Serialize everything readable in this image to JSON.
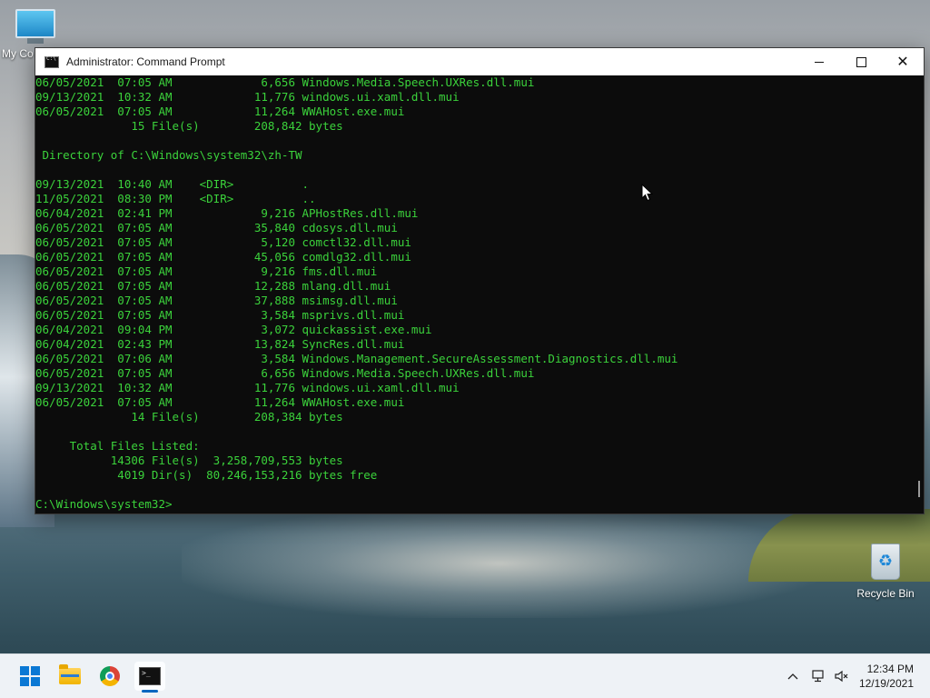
{
  "desktop": {
    "icons": [
      {
        "label": "My Co"
      },
      {
        "label": "Recycle Bin"
      }
    ]
  },
  "window": {
    "title": "Administrator: Command Prompt",
    "console_lines": [
      "06/05/2021  07:05 AM             6,656 Windows.Media.Speech.UXRes.dll.mui",
      "09/13/2021  10:32 AM            11,776 windows.ui.xaml.dll.mui",
      "06/05/2021  07:05 AM            11,264 WWAHost.exe.mui",
      "              15 File(s)        208,842 bytes",
      "",
      " Directory of C:\\Windows\\system32\\zh-TW",
      "",
      "09/13/2021  10:40 AM    <DIR>          .",
      "11/05/2021  08:30 PM    <DIR>          ..",
      "06/04/2021  02:41 PM             9,216 APHostRes.dll.mui",
      "06/05/2021  07:05 AM            35,840 cdosys.dll.mui",
      "06/05/2021  07:05 AM             5,120 comctl32.dll.mui",
      "06/05/2021  07:05 AM            45,056 comdlg32.dll.mui",
      "06/05/2021  07:05 AM             9,216 fms.dll.mui",
      "06/05/2021  07:05 AM            12,288 mlang.dll.mui",
      "06/05/2021  07:05 AM            37,888 msimsg.dll.mui",
      "06/05/2021  07:05 AM             3,584 msprivs.dll.mui",
      "06/04/2021  09:04 PM             3,072 quickassist.exe.mui",
      "06/04/2021  02:43 PM            13,824 SyncRes.dll.mui",
      "06/05/2021  07:06 AM             3,584 Windows.Management.SecureAssessment.Diagnostics.dll.mui",
      "06/05/2021  07:05 AM             6,656 Windows.Media.Speech.UXRes.dll.mui",
      "09/13/2021  10:32 AM            11,776 windows.ui.xaml.dll.mui",
      "06/05/2021  07:05 AM            11,264 WWAHost.exe.mui",
      "              14 File(s)        208,384 bytes",
      "",
      "     Total Files Listed:",
      "           14306 File(s)  3,258,709,553 bytes",
      "            4019 Dir(s)  80,246,153,216 bytes free",
      "",
      "C:\\Windows\\system32>"
    ]
  },
  "taskbar": {
    "apps": [
      "start-icon",
      "file-explorer-icon",
      "chrome-icon",
      "command-prompt-icon"
    ],
    "clock": {
      "time": "12:34 PM",
      "date": "12/19/2021"
    }
  },
  "colors": {
    "console_text": "#3bd23b",
    "console_bg": "#0c0c0c",
    "accent": "#0067c0"
  }
}
